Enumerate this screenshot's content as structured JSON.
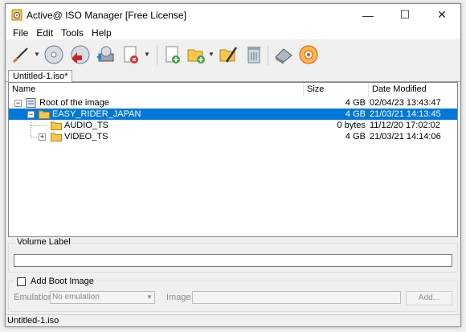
{
  "window": {
    "title": "Active@ ISO Manager [Free License]",
    "controls": {
      "minimize": "—",
      "maximize": "☐",
      "close": "✕"
    }
  },
  "menu": [
    "File",
    "Edit",
    "Tools",
    "Help"
  ],
  "toolbar": {
    "buttons": [
      "new-image-icon",
      "open-disc-icon",
      "burn-disc-icon",
      "extract-icon",
      "delete-icon",
      "add-file-icon",
      "add-folder-icon",
      "rename-icon",
      "recycle-bin-icon",
      "erase-disc-icon",
      "burn-iso-icon"
    ]
  },
  "tabs": [
    {
      "label": "Untitled-1.iso*"
    }
  ],
  "list": {
    "columns": {
      "name": "Name",
      "size": "Size",
      "date": "Date Modified"
    },
    "rows": [
      {
        "name": "Root of the image",
        "size": "4 GB",
        "date": "02/04/23 13:43:47"
      },
      {
        "name": "EASY_RIDER_JAPAN",
        "size": "4 GB",
        "date": "21/03/21 14:13:45"
      },
      {
        "name": "AUDIO_TS",
        "size": "0 bytes",
        "date": "11/12/20 17:02:02"
      },
      {
        "name": "VIDEO_TS",
        "size": "4 GB",
        "date": "21/03/21 14:14:06"
      }
    ]
  },
  "volume": {
    "label": "Volume Label",
    "value": ""
  },
  "boot": {
    "label": "Add Boot Image",
    "emulation_label": "Emulation",
    "emulation_value": "No emulation",
    "image_label": "Image",
    "image_value": "",
    "add_button": "Add..."
  },
  "status": {
    "text": "Untitled-1.iso"
  },
  "colors": {
    "selection": "#0078d7",
    "folder": "#f5c84c"
  }
}
